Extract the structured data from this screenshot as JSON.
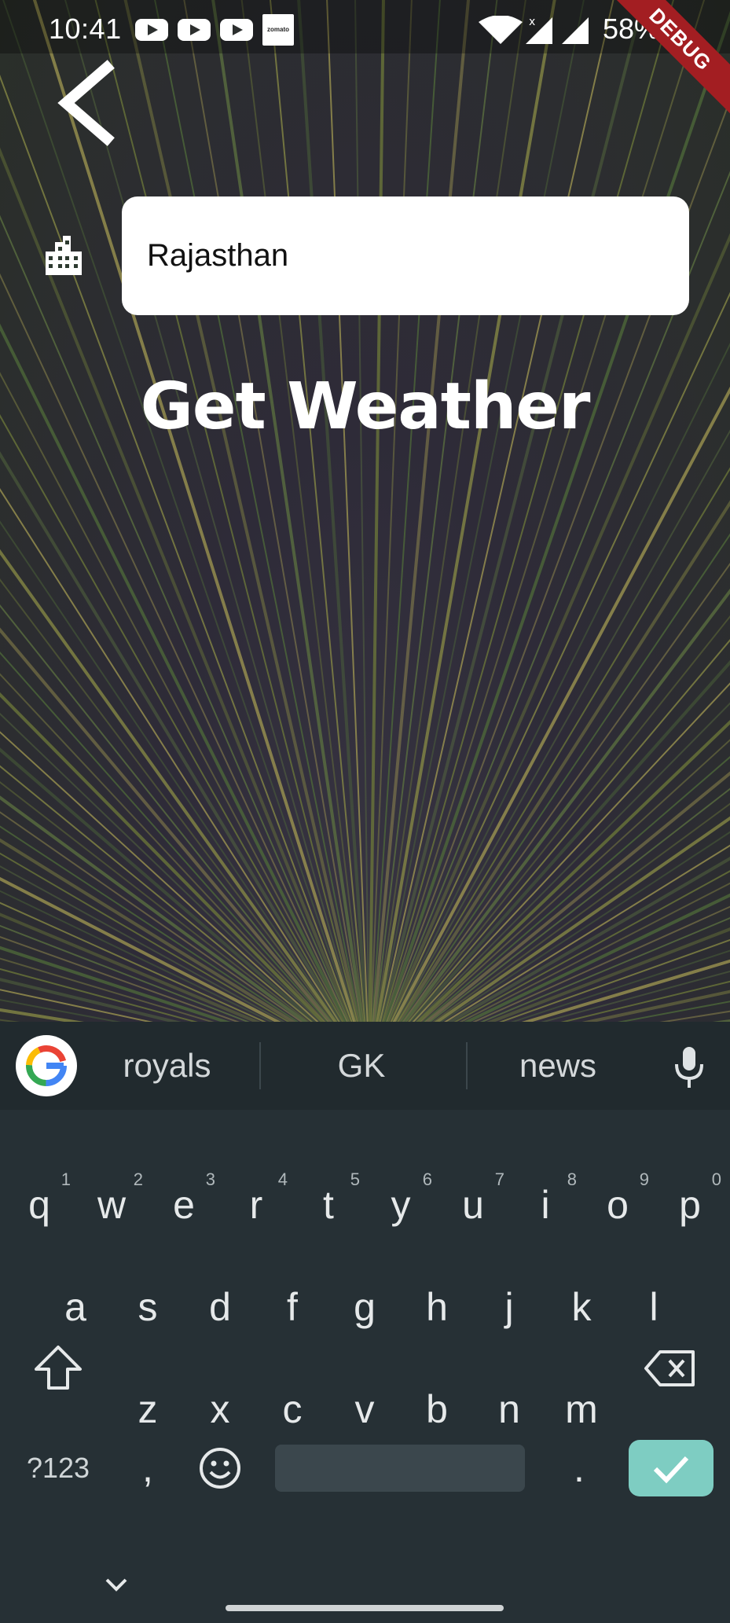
{
  "status_bar": {
    "time": "10:41",
    "battery": "58%",
    "debug_label": "DEBUG",
    "notification_icons": [
      "youtube-icon",
      "youtube-icon",
      "youtube-icon",
      "zomato-icon"
    ],
    "zomato_text": "zomato"
  },
  "page": {
    "city_input_value": "Rajasthan",
    "title": "Get Weather"
  },
  "keyboard": {
    "suggestions": [
      "royals",
      "GK",
      "news"
    ],
    "rows": [
      [
        {
          "k": "q",
          "h": "1"
        },
        {
          "k": "w",
          "h": "2"
        },
        {
          "k": "e",
          "h": "3"
        },
        {
          "k": "r",
          "h": "4"
        },
        {
          "k": "t",
          "h": "5"
        },
        {
          "k": "y",
          "h": "6"
        },
        {
          "k": "u",
          "h": "7"
        },
        {
          "k": "i",
          "h": "8"
        },
        {
          "k": "o",
          "h": "9"
        },
        {
          "k": "p",
          "h": "0"
        }
      ],
      [
        {
          "k": "a"
        },
        {
          "k": "s"
        },
        {
          "k": "d"
        },
        {
          "k": "f"
        },
        {
          "k": "g"
        },
        {
          "k": "h"
        },
        {
          "k": "j"
        },
        {
          "k": "k"
        },
        {
          "k": "l"
        }
      ],
      [
        {
          "k": "z"
        },
        {
          "k": "x"
        },
        {
          "k": "c"
        },
        {
          "k": "v"
        },
        {
          "k": "b"
        },
        {
          "k": "n"
        },
        {
          "k": "m"
        }
      ]
    ],
    "symbols_label": "?123",
    "comma": ",",
    "period": ".",
    "accent_color": "#7ecdc2"
  }
}
